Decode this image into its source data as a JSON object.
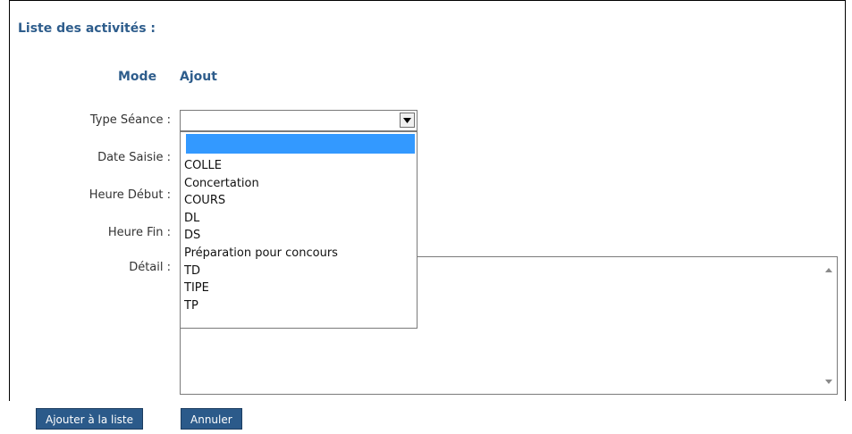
{
  "panel": {
    "title": "Liste des activités :"
  },
  "mode": {
    "label": "Mode",
    "value": "Ajout"
  },
  "fields": {
    "type_seance": "Type Séance :",
    "date_saisie": "Date Saisie :",
    "heure_debut": "Heure Début :",
    "heure_fin": "Heure Fin :",
    "detail": "Détail :"
  },
  "type_select": {
    "selected": "",
    "options": [
      "",
      "COLLE",
      "Concertation",
      "COURS",
      "DL",
      "DS",
      "Préparation pour concours",
      "TD",
      "TIPE",
      "TP"
    ]
  },
  "detail_text": "",
  "buttons": {
    "add": "Ajouter à la liste",
    "cancel": "Annuler"
  },
  "colors": {
    "heading": "#2e5d8c",
    "button_bg": "#2b5a8a",
    "selection": "#3399ff"
  }
}
